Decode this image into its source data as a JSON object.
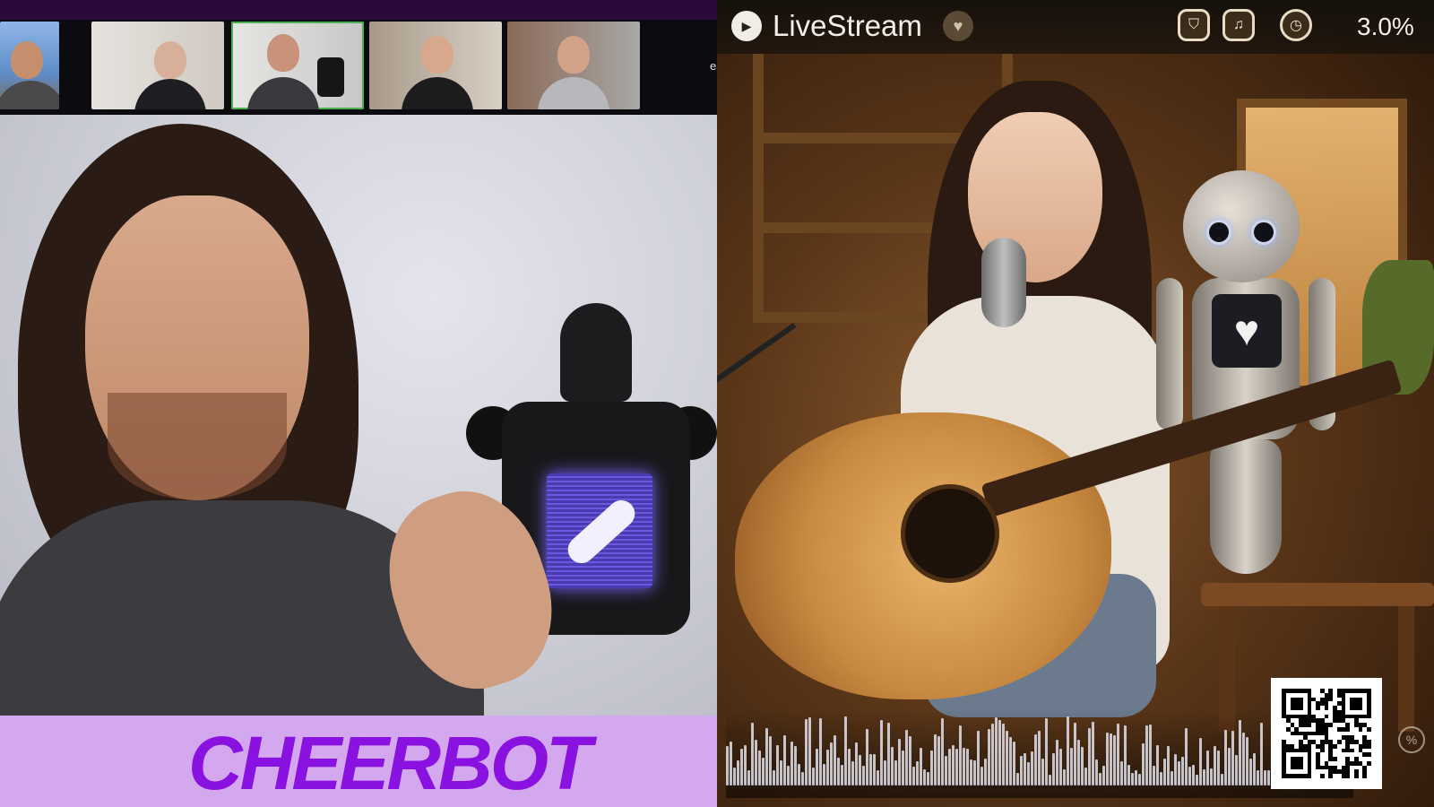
{
  "left_panel": {
    "thumbnails": [
      {
        "id": "p1",
        "active": false
      },
      {
        "id": "p2",
        "active": false
      },
      {
        "id": "p3",
        "active": true
      },
      {
        "id": "p4",
        "active": false
      },
      {
        "id": "p5",
        "active": false
      }
    ],
    "more_indicator": "e",
    "lower_third_title": "CHEERBOT",
    "colors": {
      "lower_third_bg": "#d3a8ee",
      "lower_third_text": "#8a12e0",
      "robot_screen": "#5a48cc",
      "active_tile_border": "#4caf50"
    }
  },
  "right_panel": {
    "title": "LiveStream",
    "live_icon": "play-icon",
    "badge_icon": "heart-icon",
    "top_icons": [
      "shield-icon",
      "bell-icon",
      "clock-icon"
    ],
    "percent_readout": "3.0%",
    "robot_screen_icon": "heart-icon",
    "qr_icon": "qr-code-icon",
    "corner_icon": "percent-icon",
    "colors": {
      "title_text": "#f3efe8",
      "warm_bg": "#8a5a2e"
    }
  }
}
